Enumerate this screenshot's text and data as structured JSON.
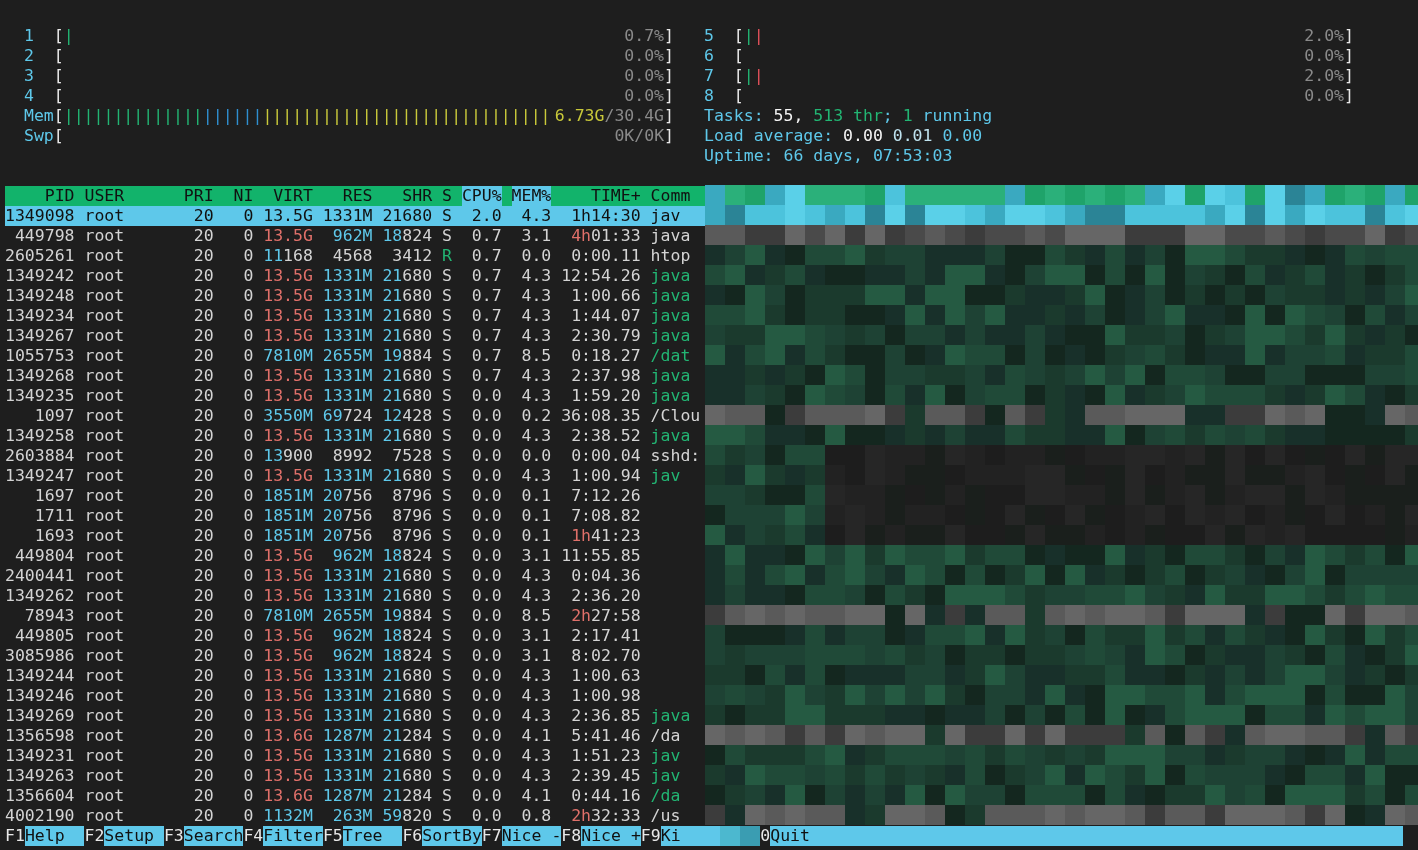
{
  "meters_left": [
    {
      "label": "1",
      "brackets": [
        "[",
        "]"
      ],
      "bars": [
        {
          "text": "|",
          "color": "#22b573"
        }
      ],
      "value": "0.7%"
    },
    {
      "label": "2",
      "brackets": [
        "[",
        "]"
      ],
      "value": "0.0%"
    },
    {
      "label": "3",
      "brackets": [
        "[",
        "]"
      ],
      "value": "0.0%"
    },
    {
      "label": "4",
      "brackets": [
        "[",
        "]"
      ],
      "value": "0.0%"
    },
    {
      "label": "Mem",
      "brackets": [
        "[",
        "]"
      ],
      "bars": [
        {
          "text": "||||||||||||||",
          "color": "#22b573"
        },
        {
          "text": "||||||",
          "color": "#2f8fd0"
        },
        {
          "text": "|||||||||||||||||||||||||||||",
          "color": "#c9c93a"
        }
      ],
      "value": [
        {
          "text": "6.73G",
          "color": "#c9c93a"
        },
        {
          "text": "/30.4G",
          "color": "#8a8a8a"
        }
      ]
    },
    {
      "label": "Swp",
      "brackets": [
        "[",
        "]"
      ],
      "value": "0K/0K"
    }
  ],
  "meters_right": [
    {
      "label": "5",
      "brackets": [
        "[",
        "]"
      ],
      "bars": [
        {
          "text": "|",
          "color": "#22b573"
        },
        {
          "text": "|",
          "color": "#e0505a"
        }
      ],
      "value": "2.0%"
    },
    {
      "label": "6",
      "brackets": [
        "[",
        "]"
      ],
      "value": "0.0%"
    },
    {
      "label": "7",
      "brackets": [
        "[",
        "]"
      ],
      "bars": [
        {
          "text": "|",
          "color": "#22b573"
        },
        {
          "text": "|",
          "color": "#e0505a"
        }
      ],
      "value": "2.0%"
    },
    {
      "label": "8",
      "brackets": [
        "[",
        "]"
      ],
      "value": "0.0%"
    }
  ],
  "summary": [
    [
      {
        "text": "Tasks: ",
        "color": "#5ec8ea"
      },
      {
        "text": "55, ",
        "color": "#f4f4f4"
      },
      {
        "text": "513 thr",
        "color": "#22b573"
      },
      {
        "text": "; ",
        "color": "#5ec8ea"
      },
      {
        "text": "1",
        "color": "#22b573"
      },
      {
        "text": " running",
        "color": "#5ec8ea"
      }
    ],
    [
      {
        "text": "Load average: ",
        "color": "#5ec8ea"
      },
      {
        "text": "0.00 ",
        "color": "#f4f4f4"
      },
      {
        "text": "0.01 ",
        "color": "#bfe3ef"
      },
      {
        "text": "0.00",
        "color": "#5ec8ea"
      }
    ],
    [
      {
        "text": "Uptime: 66 days, 07:53:03",
        "color": "#5ec8ea"
      }
    ]
  ],
  "table": {
    "columns": [
      {
        "label": "PID",
        "sorted": false
      },
      {
        "label": "USER",
        "sorted": false
      },
      {
        "label": "PRI",
        "sorted": false
      },
      {
        "label": "NI",
        "sorted": false
      },
      {
        "label": "VIRT",
        "sorted": false
      },
      {
        "label": "RES",
        "sorted": false
      },
      {
        "label": "SHR",
        "sorted": false
      },
      {
        "label": "S",
        "sorted": false
      },
      {
        "label": "CPU%",
        "sorted": true
      },
      {
        "label": "MEM%",
        "sorted": true
      },
      {
        "label": "TIME+",
        "sorted": false
      },
      {
        "label": "Comm",
        "sorted": false
      }
    ],
    "rows": [
      {
        "selected": true,
        "pid": "1349098",
        "user": "root",
        "pri": "20",
        "ni": "0",
        "virt": "13.5G",
        "res": "1331M",
        "shr": "21680",
        "s": "S",
        "cpu": "2.0",
        "mem": "4.3",
        "time": "1h14:30",
        "command": "jav"
      },
      {
        "selected": false,
        "pid": "449798",
        "user": "root",
        "pri": "20",
        "ni": "0",
        "virt": [
          {
            "text": "13.5G",
            "color": "#e0706a"
          }
        ],
        "res": [
          {
            "text": "962M",
            "color": "#5ec8ea"
          }
        ],
        "shr": [
          {
            "text": "18",
            "color": "#5ec8ea"
          },
          {
            "text": "824",
            "color": "#d4d4d4"
          }
        ],
        "s": "S",
        "cpu": "0.7",
        "mem": "3.1",
        "time": [
          {
            "text": "4h",
            "color": "#e0706a"
          },
          {
            "text": "01:33",
            "color": "#d4d4d4"
          }
        ],
        "command": "java"
      },
      {
        "selected": false,
        "pid": "2605261",
        "user": "root",
        "pri": "20",
        "ni": "0",
        "virt": [
          {
            "text": "11",
            "color": "#5ec8ea"
          },
          {
            "text": "168",
            "color": "#d4d4d4"
          }
        ],
        "res": "4568",
        "shr": "3412",
        "s": [
          {
            "text": "R",
            "color": "#22b573"
          }
        ],
        "cpu": "0.7",
        "mem": "0.0",
        "time": "0:00.11",
        "command": "htop"
      },
      {
        "selected": false,
        "pid": "1349242",
        "user": "root",
        "pri": "20",
        "ni": "0",
        "virt": [
          {
            "text": "13.5G",
            "color": "#e0706a"
          }
        ],
        "res": [
          {
            "text": "1331M",
            "color": "#5ec8ea"
          }
        ],
        "shr": [
          {
            "text": "21",
            "color": "#5ec8ea"
          },
          {
            "text": "680",
            "color": "#d4d4d4"
          }
        ],
        "s": "S",
        "cpu": "0.7",
        "mem": "4.3",
        "time": "12:54.26",
        "command": [
          {
            "text": "java",
            "color": "#22b573"
          }
        ]
      },
      {
        "selected": false,
        "pid": "1349248",
        "user": "root",
        "pri": "20",
        "ni": "0",
        "virt": [
          {
            "text": "13.5G",
            "color": "#e0706a"
          }
        ],
        "res": [
          {
            "text": "1331M",
            "color": "#5ec8ea"
          }
        ],
        "shr": [
          {
            "text": "21",
            "color": "#5ec8ea"
          },
          {
            "text": "680",
            "color": "#d4d4d4"
          }
        ],
        "s": "S",
        "cpu": "0.7",
        "mem": "4.3",
        "time": "1:00.66",
        "command": [
          {
            "text": "java",
            "color": "#22b573"
          }
        ]
      },
      {
        "selected": false,
        "pid": "1349234",
        "user": "root",
        "pri": "20",
        "ni": "0",
        "virt": [
          {
            "text": "13.5G",
            "color": "#e0706a"
          }
        ],
        "res": [
          {
            "text": "1331M",
            "color": "#5ec8ea"
          }
        ],
        "shr": [
          {
            "text": "21",
            "color": "#5ec8ea"
          },
          {
            "text": "680",
            "color": "#d4d4d4"
          }
        ],
        "s": "S",
        "cpu": "0.7",
        "mem": "4.3",
        "time": "1:44.07",
        "command": [
          {
            "text": "java",
            "color": "#22b573"
          }
        ]
      },
      {
        "selected": false,
        "pid": "1349267",
        "user": "root",
        "pri": "20",
        "ni": "0",
        "virt": [
          {
            "text": "13.5G",
            "color": "#e0706a"
          }
        ],
        "res": [
          {
            "text": "1331M",
            "color": "#5ec8ea"
          }
        ],
        "shr": [
          {
            "text": "21",
            "color": "#5ec8ea"
          },
          {
            "text": "680",
            "color": "#d4d4d4"
          }
        ],
        "s": "S",
        "cpu": "0.7",
        "mem": "4.3",
        "time": "2:30.79",
        "command": [
          {
            "text": "java",
            "color": "#22b573"
          }
        ]
      },
      {
        "selected": false,
        "pid": "1055753",
        "user": "root",
        "pri": "20",
        "ni": "0",
        "virt": [
          {
            "text": "7810M",
            "color": "#5ec8ea"
          }
        ],
        "res": [
          {
            "text": "2655M",
            "color": "#5ec8ea"
          }
        ],
        "shr": [
          {
            "text": "19",
            "color": "#5ec8ea"
          },
          {
            "text": "884",
            "color": "#d4d4d4"
          }
        ],
        "s": "S",
        "cpu": "0.7",
        "mem": "8.5",
        "time": "0:18.27",
        "command": [
          {
            "text": "/dat",
            "color": "#22b573"
          }
        ]
      },
      {
        "selected": false,
        "pid": "1349268",
        "user": "root",
        "pri": "20",
        "ni": "0",
        "virt": [
          {
            "text": "13.5G",
            "color": "#e0706a"
          }
        ],
        "res": [
          {
            "text": "1331M",
            "color": "#5ec8ea"
          }
        ],
        "shr": [
          {
            "text": "21",
            "color": "#5ec8ea"
          },
          {
            "text": "680",
            "color": "#d4d4d4"
          }
        ],
        "s": "S",
        "cpu": "0.7",
        "mem": "4.3",
        "time": "2:37.98",
        "command": [
          {
            "text": "java",
            "color": "#22b573"
          }
        ]
      },
      {
        "selected": false,
        "pid": "1349235",
        "user": "root",
        "pri": "20",
        "ni": "0",
        "virt": [
          {
            "text": "13.5G",
            "color": "#e0706a"
          }
        ],
        "res": [
          {
            "text": "1331M",
            "color": "#5ec8ea"
          }
        ],
        "shr": [
          {
            "text": "21",
            "color": "#5ec8ea"
          },
          {
            "text": "680",
            "color": "#d4d4d4"
          }
        ],
        "s": "S",
        "cpu": "0.0",
        "mem": "4.3",
        "time": "1:59.20",
        "command": [
          {
            "text": "java",
            "color": "#22b573"
          }
        ]
      },
      {
        "selected": false,
        "pid": "1097",
        "user": "root",
        "pri": "20",
        "ni": "0",
        "virt": [
          {
            "text": "3550M",
            "color": "#5ec8ea"
          }
        ],
        "res": [
          {
            "text": "69",
            "color": "#5ec8ea"
          },
          {
            "text": "724",
            "color": "#d4d4d4"
          }
        ],
        "shr": [
          {
            "text": "12",
            "color": "#5ec8ea"
          },
          {
            "text": "428",
            "color": "#d4d4d4"
          }
        ],
        "s": "S",
        "cpu": "0.0",
        "mem": "0.2",
        "time": "36:08.35",
        "command": "/Clou"
      },
      {
        "selected": false,
        "pid": "1349258",
        "user": "root",
        "pri": "20",
        "ni": "0",
        "virt": [
          {
            "text": "13.5G",
            "color": "#e0706a"
          }
        ],
        "res": [
          {
            "text": "1331M",
            "color": "#5ec8ea"
          }
        ],
        "shr": [
          {
            "text": "21",
            "color": "#5ec8ea"
          },
          {
            "text": "680",
            "color": "#d4d4d4"
          }
        ],
        "s": "S",
        "cpu": "0.0",
        "mem": "4.3",
        "time": "2:38.52",
        "command": [
          {
            "text": "java",
            "color": "#22b573"
          }
        ]
      },
      {
        "selected": false,
        "pid": "2603884",
        "user": "root",
        "pri": "20",
        "ni": "0",
        "virt": [
          {
            "text": "13",
            "color": "#5ec8ea"
          },
          {
            "text": "900",
            "color": "#d4d4d4"
          }
        ],
        "res": "8992",
        "shr": "7528",
        "s": "S",
        "cpu": "0.0",
        "mem": "0.0",
        "time": "0:00.04",
        "command": "sshd:"
      },
      {
        "selected": false,
        "pid": "1349247",
        "user": "root",
        "pri": "20",
        "ni": "0",
        "virt": [
          {
            "text": "13.5G",
            "color": "#e0706a"
          }
        ],
        "res": [
          {
            "text": "1331M",
            "color": "#5ec8ea"
          }
        ],
        "shr": [
          {
            "text": "21",
            "color": "#5ec8ea"
          },
          {
            "text": "680",
            "color": "#d4d4d4"
          }
        ],
        "s": "S",
        "cpu": "0.0",
        "mem": "4.3",
        "time": "1:00.94",
        "command": [
          {
            "text": "jav",
            "color": "#22b573"
          }
        ]
      },
      {
        "selected": false,
        "pid": "1697",
        "user": "root",
        "pri": "20",
        "ni": "0",
        "virt": [
          {
            "text": "1851M",
            "color": "#5ec8ea"
          }
        ],
        "res": [
          {
            "text": "20",
            "color": "#5ec8ea"
          },
          {
            "text": "756",
            "color": "#d4d4d4"
          }
        ],
        "shr": "8796",
        "s": "S",
        "cpu": "0.0",
        "mem": "0.1",
        "time": "7:12.26"
      },
      {
        "selected": false,
        "pid": "1711",
        "user": "root",
        "pri": "20",
        "ni": "0",
        "virt": [
          {
            "text": "1851M",
            "color": "#5ec8ea"
          }
        ],
        "res": [
          {
            "text": "20",
            "color": "#5ec8ea"
          },
          {
            "text": "756",
            "color": "#d4d4d4"
          }
        ],
        "shr": "8796",
        "s": "S",
        "cpu": "0.0",
        "mem": "0.1",
        "time": "7:08.82"
      },
      {
        "selected": false,
        "pid": "1693",
        "user": "root",
        "pri": "20",
        "ni": "0",
        "virt": [
          {
            "text": "1851M",
            "color": "#5ec8ea"
          }
        ],
        "res": [
          {
            "text": "20",
            "color": "#5ec8ea"
          },
          {
            "text": "756",
            "color": "#d4d4d4"
          }
        ],
        "shr": "8796",
        "s": "S",
        "cpu": "0.0",
        "mem": "0.1",
        "time": [
          {
            "text": "1h",
            "color": "#e0706a"
          },
          {
            "text": "41:23",
            "color": "#d4d4d4"
          }
        ]
      },
      {
        "selected": false,
        "pid": "449804",
        "user": "root",
        "pri": "20",
        "ni": "0",
        "virt": [
          {
            "text": "13.5G",
            "color": "#e0706a"
          }
        ],
        "res": [
          {
            "text": "962M",
            "color": "#5ec8ea"
          }
        ],
        "shr": [
          {
            "text": "18",
            "color": "#5ec8ea"
          },
          {
            "text": "824",
            "color": "#d4d4d4"
          }
        ],
        "s": "S",
        "cpu": "0.0",
        "mem": "3.1",
        "time": "11:55.85"
      },
      {
        "selected": false,
        "pid": "2400441",
        "user": "root",
        "pri": "20",
        "ni": "0",
        "virt": [
          {
            "text": "13.5G",
            "color": "#e0706a"
          }
        ],
        "res": [
          {
            "text": "1331M",
            "color": "#5ec8ea"
          }
        ],
        "shr": [
          {
            "text": "21",
            "color": "#5ec8ea"
          },
          {
            "text": "680",
            "color": "#d4d4d4"
          }
        ],
        "s": "S",
        "cpu": "0.0",
        "mem": "4.3",
        "time": "0:04.36"
      },
      {
        "selected": false,
        "pid": "1349262",
        "user": "root",
        "pri": "20",
        "ni": "0",
        "virt": [
          {
            "text": "13.5G",
            "color": "#e0706a"
          }
        ],
        "res": [
          {
            "text": "1331M",
            "color": "#5ec8ea"
          }
        ],
        "shr": [
          {
            "text": "21",
            "color": "#5ec8ea"
          },
          {
            "text": "680",
            "color": "#d4d4d4"
          }
        ],
        "s": "S",
        "cpu": "0.0",
        "mem": "4.3",
        "time": "2:36.20"
      },
      {
        "selected": false,
        "pid": "78943",
        "user": "root",
        "pri": "20",
        "ni": "0",
        "virt": [
          {
            "text": "7810M",
            "color": "#5ec8ea"
          }
        ],
        "res": [
          {
            "text": "2655M",
            "color": "#5ec8ea"
          }
        ],
        "shr": [
          {
            "text": "19",
            "color": "#5ec8ea"
          },
          {
            "text": "884",
            "color": "#d4d4d4"
          }
        ],
        "s": "S",
        "cpu": "0.0",
        "mem": "8.5",
        "time": [
          {
            "text": "2h",
            "color": "#e0706a"
          },
          {
            "text": "27:58",
            "color": "#d4d4d4"
          }
        ]
      },
      {
        "selected": false,
        "pid": "449805",
        "user": "root",
        "pri": "20",
        "ni": "0",
        "virt": [
          {
            "text": "13.5G",
            "color": "#e0706a"
          }
        ],
        "res": [
          {
            "text": "962M",
            "color": "#5ec8ea"
          }
        ],
        "shr": [
          {
            "text": "18",
            "color": "#5ec8ea"
          },
          {
            "text": "824",
            "color": "#d4d4d4"
          }
        ],
        "s": "S",
        "cpu": "0.0",
        "mem": "3.1",
        "time": "2:17.41"
      },
      {
        "selected": false,
        "pid": "3085986",
        "user": "root",
        "pri": "20",
        "ni": "0",
        "virt": [
          {
            "text": "13.5G",
            "color": "#e0706a"
          }
        ],
        "res": [
          {
            "text": "962M",
            "color": "#5ec8ea"
          }
        ],
        "shr": [
          {
            "text": "18",
            "color": "#5ec8ea"
          },
          {
            "text": "824",
            "color": "#d4d4d4"
          }
        ],
        "s": "S",
        "cpu": "0.0",
        "mem": "3.1",
        "time": "8:02.70"
      },
      {
        "selected": false,
        "pid": "1349244",
        "user": "root",
        "pri": "20",
        "ni": "0",
        "virt": [
          {
            "text": "13.5G",
            "color": "#e0706a"
          }
        ],
        "res": [
          {
            "text": "1331M",
            "color": "#5ec8ea"
          }
        ],
        "shr": [
          {
            "text": "21",
            "color": "#5ec8ea"
          },
          {
            "text": "680",
            "color": "#d4d4d4"
          }
        ],
        "s": "S",
        "cpu": "0.0",
        "mem": "4.3",
        "time": "1:00.63"
      },
      {
        "selected": false,
        "pid": "1349246",
        "user": "root",
        "pri": "20",
        "ni": "0",
        "virt": [
          {
            "text": "13.5G",
            "color": "#e0706a"
          }
        ],
        "res": [
          {
            "text": "1331M",
            "color": "#5ec8ea"
          }
        ],
        "shr": [
          {
            "text": "21",
            "color": "#5ec8ea"
          },
          {
            "text": "680",
            "color": "#d4d4d4"
          }
        ],
        "s": "S",
        "cpu": "0.0",
        "mem": "4.3",
        "time": "1:00.98"
      },
      {
        "selected": false,
        "pid": "1349269",
        "user": "root",
        "pri": "20",
        "ni": "0",
        "virt": [
          {
            "text": "13.5G",
            "color": "#e0706a"
          }
        ],
        "res": [
          {
            "text": "1331M",
            "color": "#5ec8ea"
          }
        ],
        "shr": [
          {
            "text": "21",
            "color": "#5ec8ea"
          },
          {
            "text": "680",
            "color": "#d4d4d4"
          }
        ],
        "s": "S",
        "cpu": "0.0",
        "mem": "4.3",
        "time": "2:36.85",
        "command": [
          {
            "text": "java",
            "color": "#22b573"
          }
        ]
      },
      {
        "selected": false,
        "pid": "1356598",
        "user": "root",
        "pri": "20",
        "ni": "0",
        "virt": [
          {
            "text": "13.6G",
            "color": "#e0706a"
          }
        ],
        "res": [
          {
            "text": "1287M",
            "color": "#5ec8ea"
          }
        ],
        "shr": [
          {
            "text": "21",
            "color": "#5ec8ea"
          },
          {
            "text": "284",
            "color": "#d4d4d4"
          }
        ],
        "s": "S",
        "cpu": "0.0",
        "mem": "4.1",
        "time": "5:41.46",
        "command": "/da"
      },
      {
        "selected": false,
        "pid": "1349231",
        "user": "root",
        "pri": "20",
        "ni": "0",
        "virt": [
          {
            "text": "13.5G",
            "color": "#e0706a"
          }
        ],
        "res": [
          {
            "text": "1331M",
            "color": "#5ec8ea"
          }
        ],
        "shr": [
          {
            "text": "21",
            "color": "#5ec8ea"
          },
          {
            "text": "680",
            "color": "#d4d4d4"
          }
        ],
        "s": "S",
        "cpu": "0.0",
        "mem": "4.3",
        "time": "1:51.23",
        "command": [
          {
            "text": "jav",
            "color": "#22b573"
          }
        ]
      },
      {
        "selected": false,
        "pid": "1349263",
        "user": "root",
        "pri": "20",
        "ni": "0",
        "virt": [
          {
            "text": "13.5G",
            "color": "#e0706a"
          }
        ],
        "res": [
          {
            "text": "1331M",
            "color": "#5ec8ea"
          }
        ],
        "shr": [
          {
            "text": "21",
            "color": "#5ec8ea"
          },
          {
            "text": "680",
            "color": "#d4d4d4"
          }
        ],
        "s": "S",
        "cpu": "0.0",
        "mem": "4.3",
        "time": "2:39.45",
        "command": [
          {
            "text": "jav",
            "color": "#22b573"
          }
        ]
      },
      {
        "selected": false,
        "pid": "1356604",
        "user": "root",
        "pri": "20",
        "ni": "0",
        "virt": [
          {
            "text": "13.6G",
            "color": "#e0706a"
          }
        ],
        "res": [
          {
            "text": "1287M",
            "color": "#5ec8ea"
          }
        ],
        "shr": [
          {
            "text": "21",
            "color": "#5ec8ea"
          },
          {
            "text": "284",
            "color": "#d4d4d4"
          }
        ],
        "s": "S",
        "cpu": "0.0",
        "mem": "4.1",
        "time": "0:44.16",
        "command": [
          {
            "text": "/da",
            "color": "#22b573"
          }
        ]
      },
      {
        "selected": false,
        "pid": "4002190",
        "user": "root",
        "pri": "20",
        "ni": "0",
        "virt": [
          {
            "text": "1132M",
            "color": "#5ec8ea"
          }
        ],
        "res": [
          {
            "text": "263M",
            "color": "#5ec8ea"
          }
        ],
        "shr": [
          {
            "text": "59",
            "color": "#5ec8ea"
          },
          {
            "text": "820",
            "color": "#d4d4d4"
          }
        ],
        "s": "S",
        "cpu": "0.0",
        "mem": "0.8",
        "time": [
          {
            "text": "2h",
            "color": "#e0706a"
          },
          {
            "text": "32:33",
            "color": "#d4d4d4"
          }
        ],
        "command": "/us"
      }
    ]
  },
  "function_keys": [
    {
      "kind": "key",
      "key": "F1",
      "label": "Help"
    },
    {
      "kind": "key",
      "key": "F2",
      "label": "Setup"
    },
    {
      "kind": "key",
      "key": "F3",
      "label": "Search"
    },
    {
      "kind": "key",
      "key": "F4",
      "label": "Filter"
    },
    {
      "kind": "key",
      "key": "F5",
      "label": "Tree"
    },
    {
      "kind": "key",
      "key": "F6",
      "label": "SortBy"
    },
    {
      "kind": "key",
      "key": "F7",
      "label": "Nice -"
    },
    {
      "kind": "key",
      "key": "F8",
      "label": "Nice +"
    },
    {
      "kind": "key",
      "key": "F9",
      "label": "Ki"
    },
    {
      "kind": "redaction"
    },
    {
      "kind": "key",
      "key": "0",
      "label": "Quit"
    }
  ]
}
